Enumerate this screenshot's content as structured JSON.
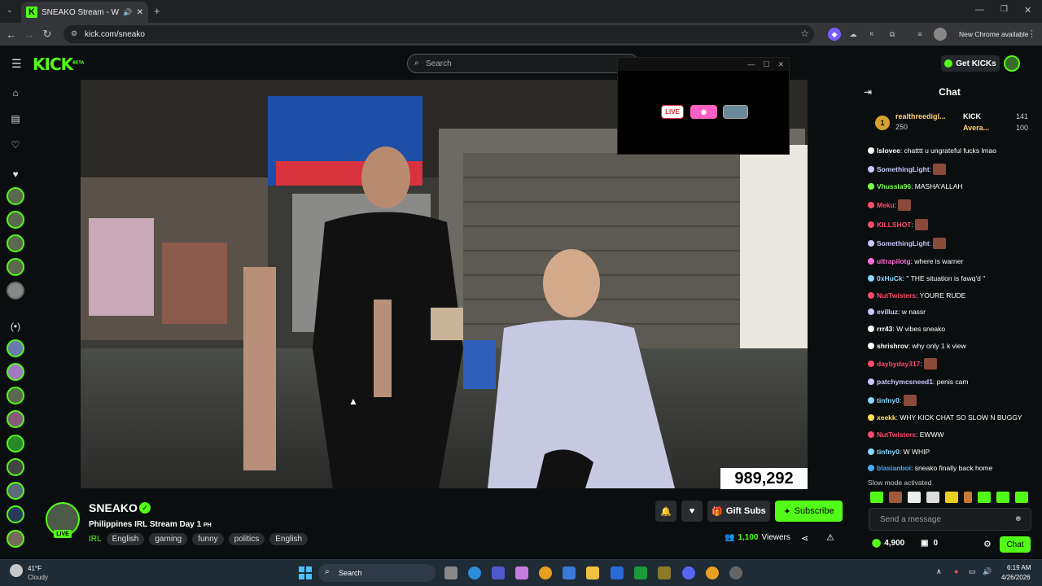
{
  "browser": {
    "tab_title": "SNEAKO Stream - Watch Li",
    "url": "kick.com/sneako",
    "new_chrome": "New Chrome available"
  },
  "header": {
    "logo": "KICK",
    "logo_beta": "BETA",
    "search_placeholder": "Search",
    "get_kicks": "Get KICKs"
  },
  "video": {
    "viewer_overlay": "989,292"
  },
  "popup": {
    "badges": [
      "LIVE"
    ]
  },
  "channel": {
    "name": "SNEAKO",
    "live_label": "LIVE",
    "stream_title": "Philippines IRL Stream Day 1",
    "stream_title_flag": "PH",
    "category": "IRL",
    "tags": [
      "English",
      "gaming",
      "funny",
      "politics",
      "English"
    ],
    "gift_subs": "Gift Subs",
    "subscribe": "Subscribe",
    "viewers_count": "1,100",
    "viewers_label": "Viewers"
  },
  "chat": {
    "title": "Chat",
    "leaderboard": [
      {
        "rank": "1",
        "name": "realthreedigl...",
        "points": "250"
      },
      {
        "name": "KICK",
        "points": "141"
      },
      {
        "name": "Avera...",
        "points": "100"
      }
    ],
    "messages": [
      {
        "user": "lslovee",
        "text": "chatttt u ungrateful fucks lmao",
        "color": "#ffffff"
      },
      {
        "user": "SomethingLight",
        "text": "",
        "color": "#c6c8ff",
        "emote": true
      },
      {
        "user": "Vhussla96",
        "text": "MASHA'ALLAH",
        "color": "#7dff4a"
      },
      {
        "user": "Meku",
        "text": "",
        "color": "#ff4b6e",
        "emote": true
      },
      {
        "user": "KILLSHOT",
        "text": "",
        "color": "#ff4b6e",
        "emote": true
      },
      {
        "user": "SomethingLight",
        "text": "",
        "color": "#c6c8ff",
        "emote": true
      },
      {
        "user": "ultrapilotg",
        "text": "where is warner",
        "color": "#ff6bd8"
      },
      {
        "user": "0xHuCk",
        "text": "\" THE situation is fawq'd \"",
        "color": "#8ad8ff"
      },
      {
        "user": "NutTwisters",
        "text": "YOURE RUDE",
        "color": "#ff4b6e"
      },
      {
        "user": "evilluz",
        "text": "w nassr",
        "color": "#c6c8ff"
      },
      {
        "user": "rrr43",
        "text": "W vibes sneako",
        "color": "#ffffff"
      },
      {
        "user": "shrishrov",
        "text": "why only 1 k view",
        "color": "#ffffff"
      },
      {
        "user": "daybyday317",
        "text": "",
        "color": "#ff4b6e",
        "emote": true
      },
      {
        "user": "patchymcsneed1",
        "text": "penis cam",
        "color": "#c6c8ff"
      },
      {
        "user": "tinfny0",
        "text": "",
        "color": "#8ad8ff",
        "emote": true
      },
      {
        "user": "xeekk",
        "text": "WHY KICK CHAT SO SLOW N BUGGY",
        "color": "#ffe15a"
      },
      {
        "user": "NutTwisters",
        "text": "EWWW",
        "color": "#ff4b6e"
      },
      {
        "user": "tinfny0",
        "text": "W WHIP",
        "color": "#8ad8ff"
      },
      {
        "user": "blasianboi",
        "text": "sneako finally back home",
        "color": "#4aa8ff"
      }
    ],
    "slow_mode": "Slow mode activated",
    "send_placeholder": "Send a message",
    "kicks_balance": "4,900",
    "sub_count": "0",
    "chat_button": "Chat"
  },
  "taskbar": {
    "weather_temp": "41°F",
    "weather_desc": "Cloudy",
    "search": "Search",
    "time": "6:19 AM",
    "date": "4/26/2026"
  },
  "colors": {
    "accent": "#53fc18",
    "bg": "#0b0e0f"
  }
}
